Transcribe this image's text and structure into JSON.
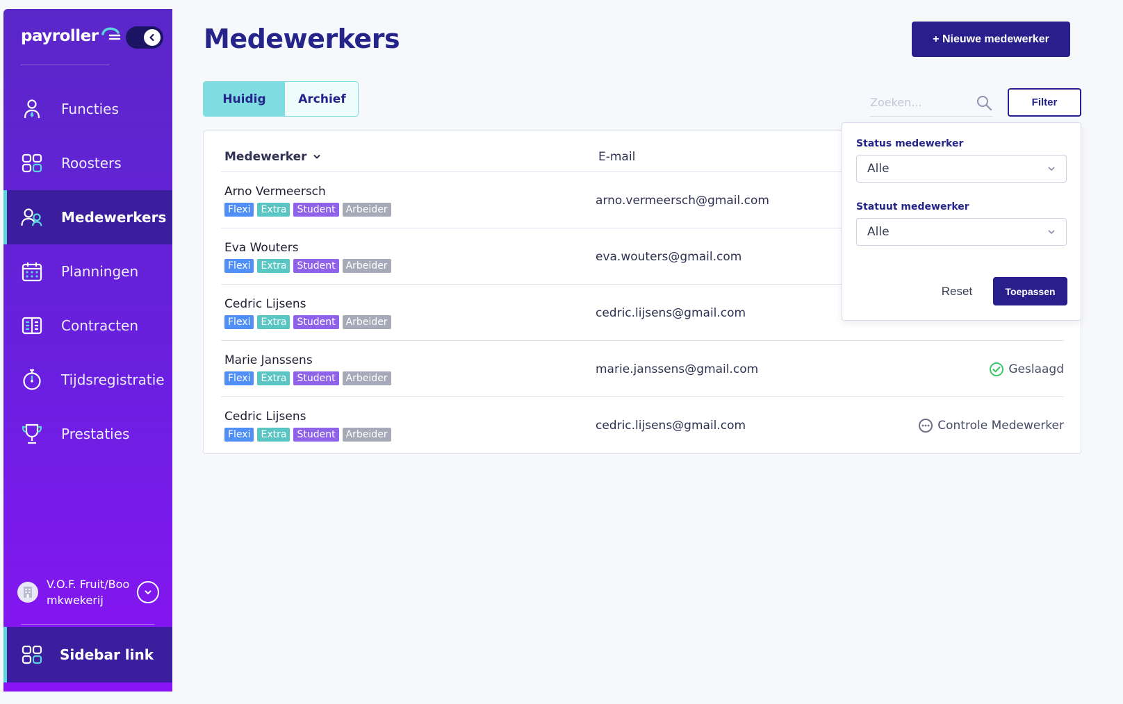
{
  "app": {
    "logo_text": "payroller",
    "brand_color": "#281f8d",
    "accent_color": "#5ad5dc"
  },
  "sidebar": {
    "items": [
      {
        "label": "Functies",
        "icon": "person-icon",
        "active": false
      },
      {
        "label": "Roosters",
        "icon": "grid-icon",
        "active": false
      },
      {
        "label": "Medewerkers",
        "icon": "users-icon",
        "active": true
      },
      {
        "label": "Planningen",
        "icon": "calendar-icon",
        "active": false
      },
      {
        "label": "Contracten",
        "icon": "contract-icon",
        "active": false
      },
      {
        "label": "Tijdsregistratie",
        "icon": "stopwatch-icon",
        "active": false
      },
      {
        "label": "Prestaties",
        "icon": "trophy-icon",
        "active": false
      }
    ],
    "company_name": "V.O.F. Fruit/Boomkwekerij",
    "bottom_link": "Sidebar link"
  },
  "header": {
    "title": "Medewerkers",
    "new_button": "+ Nieuwe medewerker"
  },
  "tabs": [
    {
      "label": "Huidig",
      "active": true
    },
    {
      "label": "Archief",
      "active": false
    }
  ],
  "search": {
    "placeholder": "Zoeken..."
  },
  "filter_button": "Filter",
  "table": {
    "columns": [
      "Medewerker",
      "E-mail"
    ],
    "badge_labels": [
      "Flexi",
      "Extra",
      "Student",
      "Arbeider"
    ],
    "rows": [
      {
        "name": "Arno Vermeersch",
        "email": "arno.vermeersch@gmail.com",
        "status": ""
      },
      {
        "name": "Eva Wouters",
        "email": "eva.wouters@gmail.com",
        "status": ""
      },
      {
        "name": "Cedric Lijsens",
        "email": "cedric.lijsens@gmail.com",
        "status": ""
      },
      {
        "name": "Marie Janssens",
        "email": "marie.janssens@gmail.com",
        "status": "Geslaagd"
      },
      {
        "name": "Cedric Lijsens",
        "email": "cedric.lijsens@gmail.com",
        "status": "Controle Medewerker"
      }
    ]
  },
  "filter_panel": {
    "status_label": "Status medewerker",
    "status_value": "Alle",
    "statuut_label": "Statuut medewerker",
    "statuut_value": "Alle",
    "reset": "Reset",
    "apply": "Toepassen"
  }
}
